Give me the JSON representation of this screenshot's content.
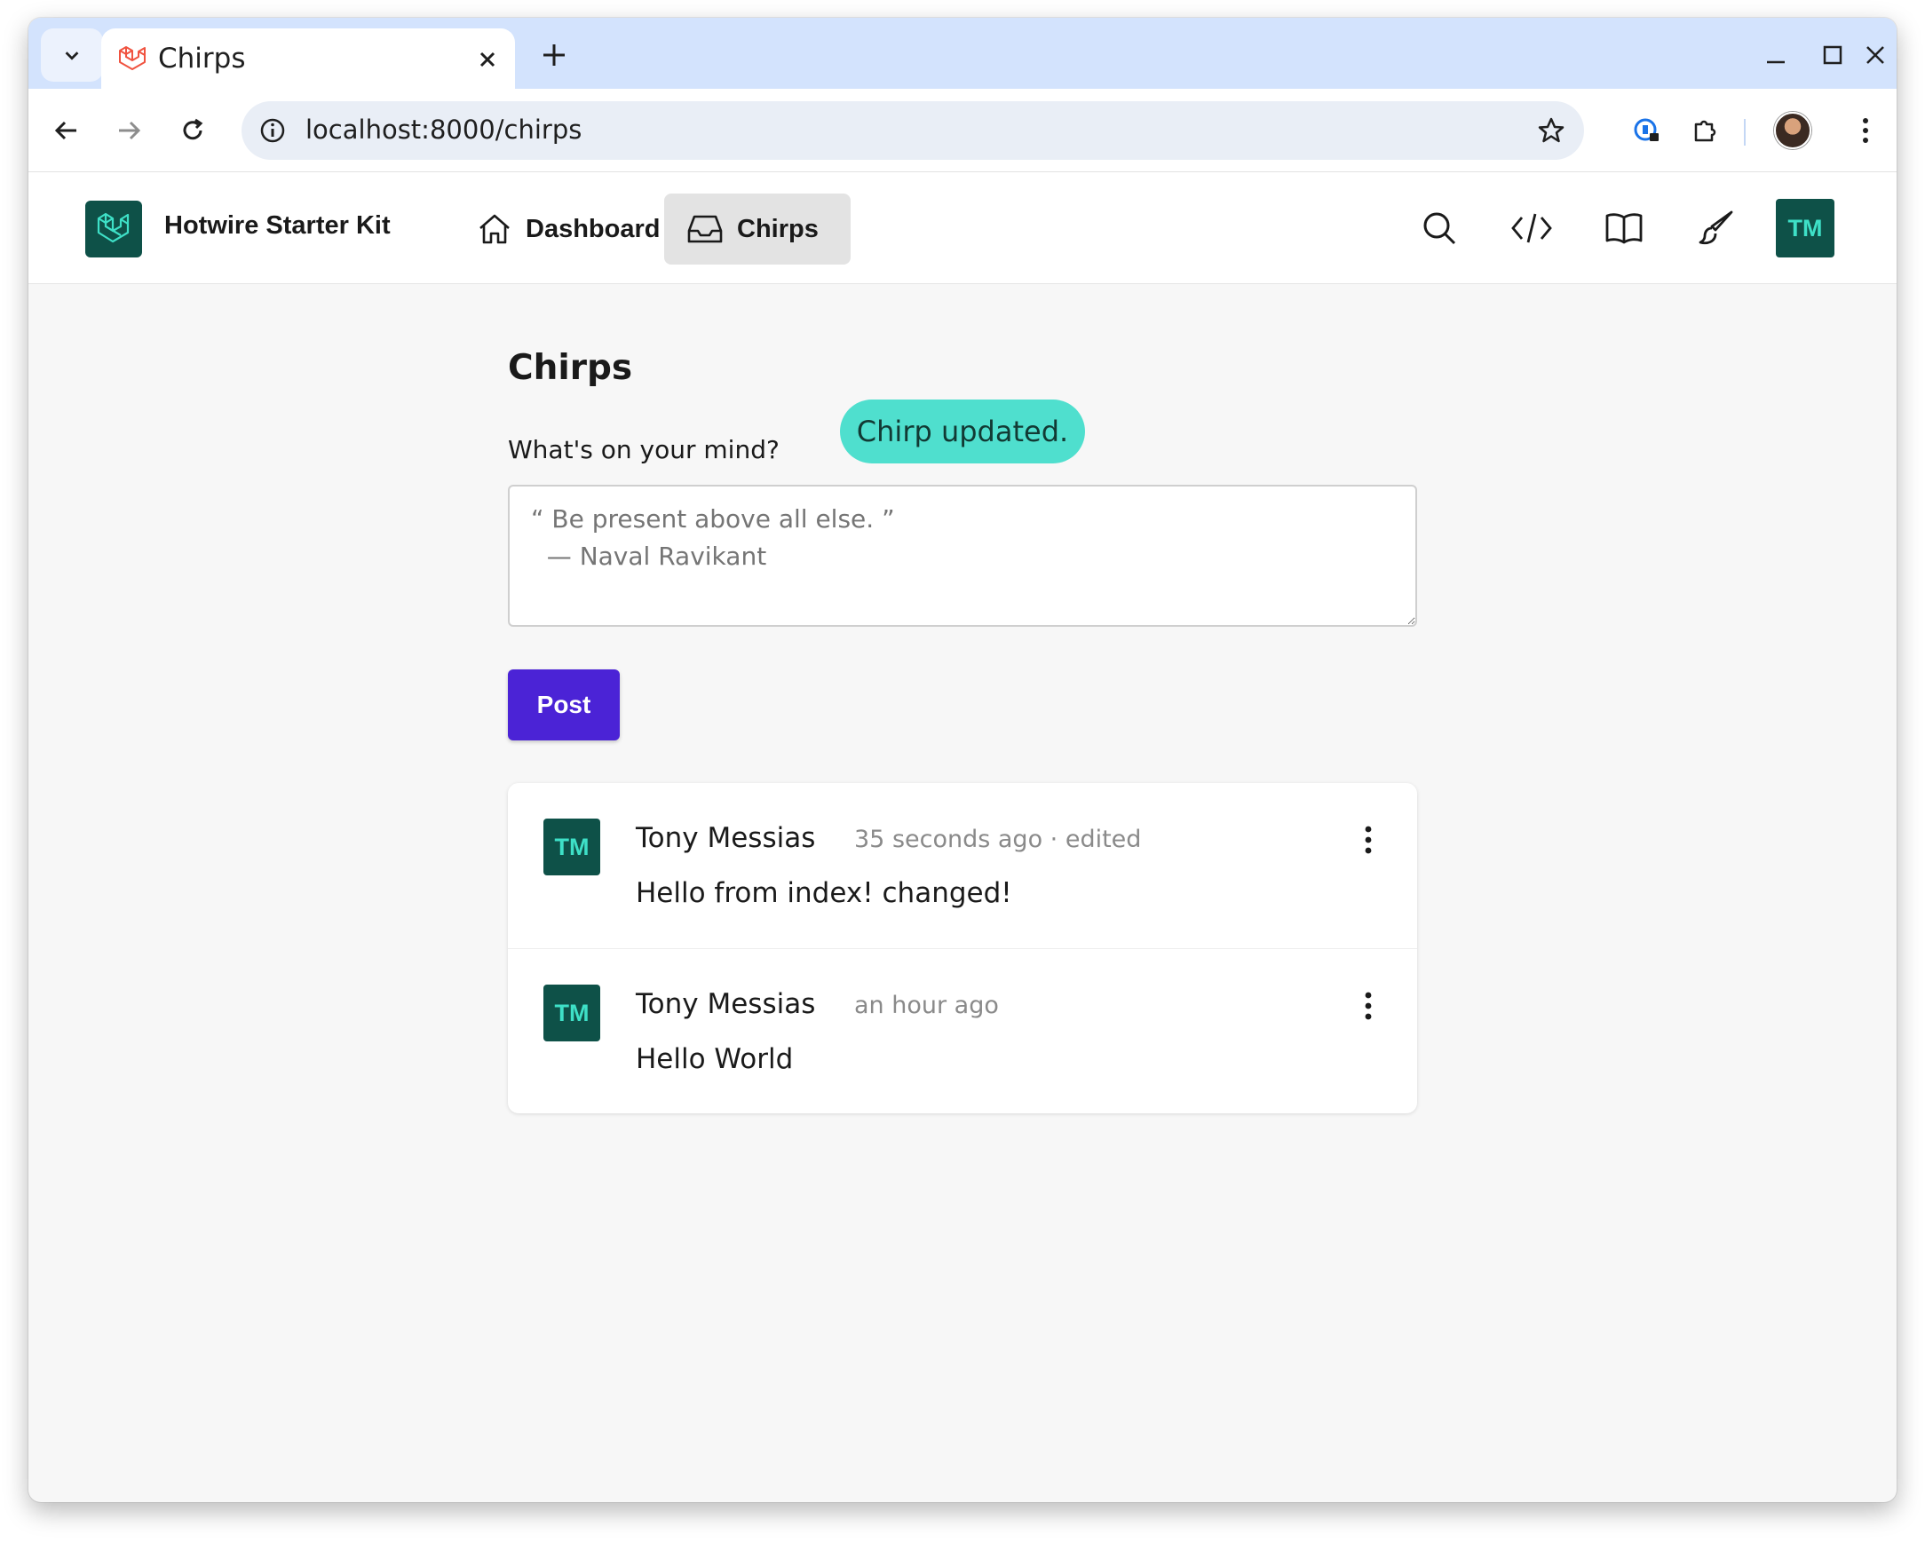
{
  "browser": {
    "tab": {
      "title": "Chirps"
    },
    "url": "localhost:8000/chirps"
  },
  "app": {
    "brand": "Hotwire Starter Kit",
    "nav": [
      {
        "label": "Dashboard",
        "active": false
      },
      {
        "label": "Chirps",
        "active": true
      }
    ],
    "user_initials": "TM"
  },
  "colors": {
    "accent": "#4b23d6",
    "toast": "#4fdfce",
    "avatar_bg": "#0e5148",
    "avatar_text": "#3ee0c7"
  },
  "main": {
    "title": "Chirps",
    "prompt_label": "What's on your mind?",
    "composer_placeholder": "“ Be present above all else. ”\n  — Naval Ravikant",
    "post_button": "Post",
    "toast": "Chirp updated."
  },
  "chirps": [
    {
      "initials": "TM",
      "author": "Tony Messias",
      "meta": "35 seconds ago · edited",
      "body": "Hello from index! changed!"
    },
    {
      "initials": "TM",
      "author": "Tony Messias",
      "meta": "an hour ago",
      "body": "Hello World"
    }
  ]
}
